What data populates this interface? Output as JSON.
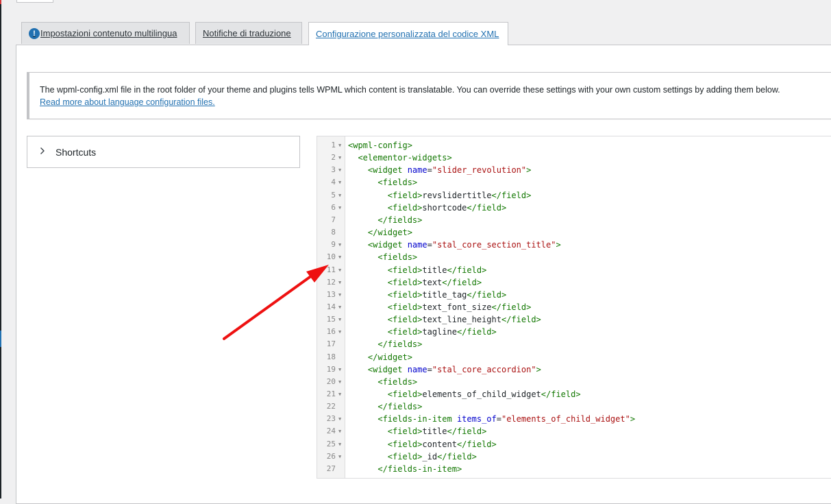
{
  "tabs": [
    {
      "label": "Impostazioni contenuto multilingua",
      "icon": "info-icon",
      "active": false
    },
    {
      "label": "Notifiche di traduzione",
      "active": false
    },
    {
      "label": "Configurazione personalizzata del codice XML",
      "active": true
    }
  ],
  "notice": {
    "text": "The wpml-config.xml file in the root folder of your theme and plugins tells WPML which content is translatable. You can override these settings with your own custom settings by adding them below.",
    "link": "Read more about language configuration files."
  },
  "shortcuts": {
    "label": "Shortcuts",
    "icon": "chevron-right-icon"
  },
  "editor": {
    "lines": [
      [
        [
          "t",
          "<wpml-config>"
        ]
      ],
      [
        [
          "",
          "  "
        ],
        [
          "t",
          "<elementor-widgets>"
        ]
      ],
      [
        [
          "",
          "    "
        ],
        [
          "t",
          "<widget "
        ],
        [
          "a",
          "name"
        ],
        [
          "",
          "="
        ],
        [
          "s",
          "\"slider_revolution\""
        ],
        [
          "t",
          ">"
        ]
      ],
      [
        [
          "",
          "      "
        ],
        [
          "t",
          "<fields>"
        ]
      ],
      [
        [
          "",
          "        "
        ],
        [
          "t",
          "<field>"
        ],
        [
          "",
          "revslidertitle"
        ],
        [
          "t",
          "</field>"
        ]
      ],
      [
        [
          "",
          "        "
        ],
        [
          "t",
          "<field>"
        ],
        [
          "",
          "shortcode"
        ],
        [
          "t",
          "</field>"
        ]
      ],
      [
        [
          "",
          "      "
        ],
        [
          "t",
          "</fields>"
        ]
      ],
      [
        [
          "",
          "    "
        ],
        [
          "t",
          "</widget>"
        ]
      ],
      [
        [
          "",
          "    "
        ],
        [
          "t",
          "<widget "
        ],
        [
          "a",
          "name"
        ],
        [
          "",
          "="
        ],
        [
          "s",
          "\"stal_core_section_title\""
        ],
        [
          "t",
          ">"
        ]
      ],
      [
        [
          "",
          "      "
        ],
        [
          "t",
          "<fields>"
        ]
      ],
      [
        [
          "",
          "        "
        ],
        [
          "t",
          "<field>"
        ],
        [
          "",
          "title"
        ],
        [
          "t",
          "</field>"
        ]
      ],
      [
        [
          "",
          "        "
        ],
        [
          "t",
          "<field>"
        ],
        [
          "",
          "text"
        ],
        [
          "t",
          "</field>"
        ]
      ],
      [
        [
          "",
          "        "
        ],
        [
          "t",
          "<field>"
        ],
        [
          "",
          "title_tag"
        ],
        [
          "t",
          "</field>"
        ]
      ],
      [
        [
          "",
          "        "
        ],
        [
          "t",
          "<field>"
        ],
        [
          "",
          "text_font_size"
        ],
        [
          "t",
          "</field>"
        ]
      ],
      [
        [
          "",
          "        "
        ],
        [
          "t",
          "<field>"
        ],
        [
          "",
          "text_line_height"
        ],
        [
          "t",
          "</field>"
        ]
      ],
      [
        [
          "",
          "        "
        ],
        [
          "t",
          "<field>"
        ],
        [
          "",
          "tagline"
        ],
        [
          "t",
          "</field>"
        ]
      ],
      [
        [
          "",
          "      "
        ],
        [
          "t",
          "</fields>"
        ]
      ],
      [
        [
          "",
          "    "
        ],
        [
          "t",
          "</widget>"
        ]
      ],
      [
        [
          "",
          "    "
        ],
        [
          "t",
          "<widget "
        ],
        [
          "a",
          "name"
        ],
        [
          "",
          "="
        ],
        [
          "s",
          "\"stal_core_accordion\""
        ],
        [
          "t",
          ">"
        ]
      ],
      [
        [
          "",
          "      "
        ],
        [
          "t",
          "<fields>"
        ]
      ],
      [
        [
          "",
          "        "
        ],
        [
          "t",
          "<field>"
        ],
        [
          "",
          "elements_of_child_widget"
        ],
        [
          "t",
          "</field>"
        ]
      ],
      [
        [
          "",
          "      "
        ],
        [
          "t",
          "</fields>"
        ]
      ],
      [
        [
          "",
          "      "
        ],
        [
          "t",
          "<fields-in-item "
        ],
        [
          "a",
          "items_of"
        ],
        [
          "",
          "="
        ],
        [
          "s",
          "\"elements_of_child_widget\""
        ],
        [
          "t",
          ">"
        ]
      ],
      [
        [
          "",
          "        "
        ],
        [
          "t",
          "<field>"
        ],
        [
          "",
          "title"
        ],
        [
          "t",
          "</field>"
        ]
      ],
      [
        [
          "",
          "        "
        ],
        [
          "t",
          "<field>"
        ],
        [
          "",
          "content"
        ],
        [
          "t",
          "</field>"
        ]
      ],
      [
        [
          "",
          "        "
        ],
        [
          "t",
          "<field>"
        ],
        [
          "",
          "_id"
        ],
        [
          "t",
          "</field>"
        ]
      ],
      [
        [
          "",
          "      "
        ],
        [
          "t",
          "</fields-in-item>"
        ]
      ]
    ],
    "foldable": [
      1,
      2,
      3,
      4,
      5,
      6,
      9,
      10,
      11,
      12,
      13,
      14,
      15,
      16,
      19,
      20,
      21,
      23,
      24,
      25,
      26
    ]
  },
  "colors": {
    "accent": "#2271b1",
    "tag": "#117700",
    "attribute": "#0000cc",
    "string": "#aa1111",
    "arrow": "#ee1111"
  }
}
